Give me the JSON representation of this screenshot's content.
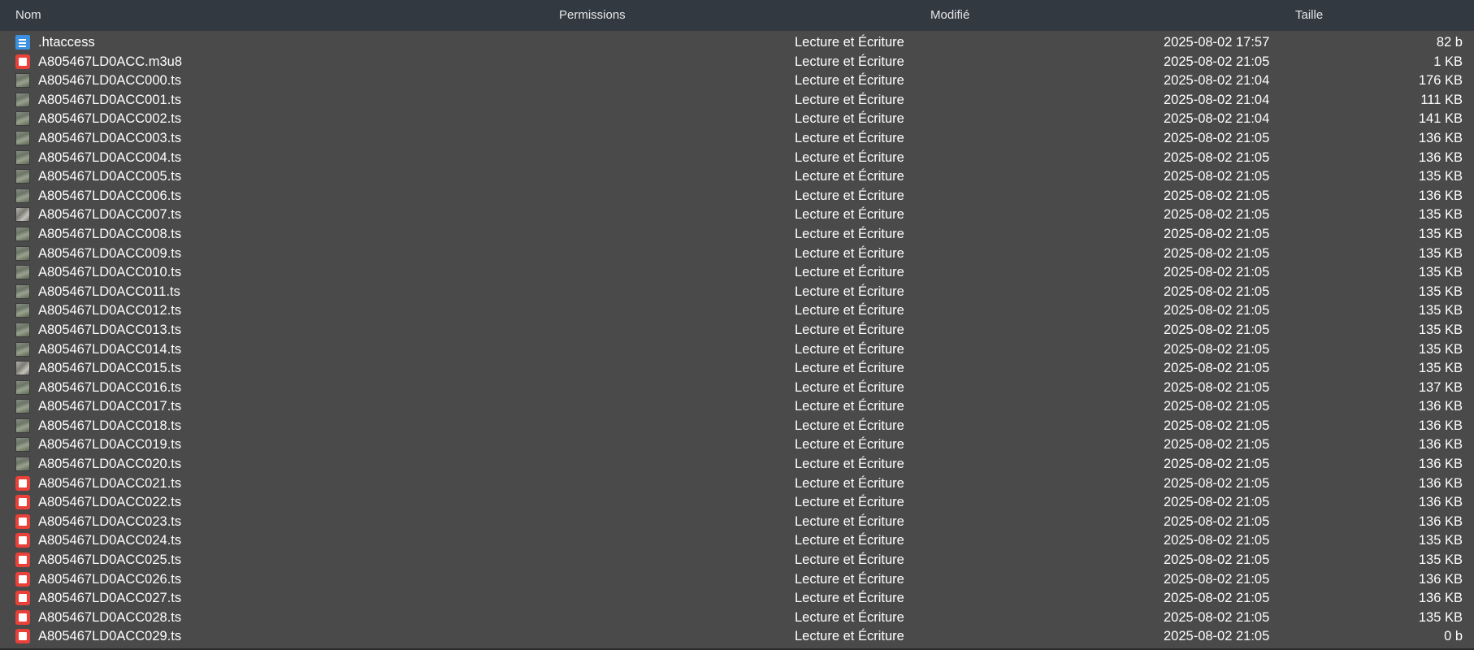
{
  "columns": {
    "name": "Nom",
    "permissions": "Permissions",
    "modified": "Modifié",
    "size": "Taille"
  },
  "icons": {
    "text": "text-file-icon",
    "playlist": "media-file-icon",
    "thumbnail": "video-thumbnail-icon"
  },
  "colors": {
    "header_bg": "#333940",
    "panel_bg": "#4a4a4a",
    "doc_icon": "#3d8fe0",
    "media_icon": "#e8413a"
  },
  "files": [
    {
      "name": ".htaccess",
      "permissions": "Lecture et Écriture",
      "modified": "2025-08-02 17:57",
      "size": "82 b",
      "icon": "text-file-icon"
    },
    {
      "name": "A805467LD0ACC.m3u8",
      "permissions": "Lecture et Écriture",
      "modified": "2025-08-02 21:05",
      "size": "1 KB",
      "icon": "media-file-icon"
    },
    {
      "name": "A805467LD0ACC000.ts",
      "permissions": "Lecture et Écriture",
      "modified": "2025-08-02 21:04",
      "size": "176 KB",
      "icon": "video-thumbnail-icon"
    },
    {
      "name": "A805467LD0ACC001.ts",
      "permissions": "Lecture et Écriture",
      "modified": "2025-08-02 21:04",
      "size": "111 KB",
      "icon": "video-thumbnail-icon"
    },
    {
      "name": "A805467LD0ACC002.ts",
      "permissions": "Lecture et Écriture",
      "modified": "2025-08-02 21:04",
      "size": "141 KB",
      "icon": "video-thumbnail-icon"
    },
    {
      "name": "A805467LD0ACC003.ts",
      "permissions": "Lecture et Écriture",
      "modified": "2025-08-02 21:05",
      "size": "136 KB",
      "icon": "video-thumbnail-icon"
    },
    {
      "name": "A805467LD0ACC004.ts",
      "permissions": "Lecture et Écriture",
      "modified": "2025-08-02 21:05",
      "size": "136 KB",
      "icon": "video-thumbnail-icon"
    },
    {
      "name": "A805467LD0ACC005.ts",
      "permissions": "Lecture et Écriture",
      "modified": "2025-08-02 21:05",
      "size": "135 KB",
      "icon": "video-thumbnail-icon"
    },
    {
      "name": "A805467LD0ACC006.ts",
      "permissions": "Lecture et Écriture",
      "modified": "2025-08-02 21:05",
      "size": "136 KB",
      "icon": "video-thumbnail-icon"
    },
    {
      "name": "A805467LD0ACC007.ts",
      "permissions": "Lecture et Écriture",
      "modified": "2025-08-02 21:05",
      "size": "135 KB",
      "icon": "video-thumbnail-icon"
    },
    {
      "name": "A805467LD0ACC008.ts",
      "permissions": "Lecture et Écriture",
      "modified": "2025-08-02 21:05",
      "size": "135 KB",
      "icon": "video-thumbnail-icon"
    },
    {
      "name": "A805467LD0ACC009.ts",
      "permissions": "Lecture et Écriture",
      "modified": "2025-08-02 21:05",
      "size": "135 KB",
      "icon": "video-thumbnail-icon"
    },
    {
      "name": "A805467LD0ACC010.ts",
      "permissions": "Lecture et Écriture",
      "modified": "2025-08-02 21:05",
      "size": "135 KB",
      "icon": "video-thumbnail-icon"
    },
    {
      "name": "A805467LD0ACC011.ts",
      "permissions": "Lecture et Écriture",
      "modified": "2025-08-02 21:05",
      "size": "135 KB",
      "icon": "video-thumbnail-icon"
    },
    {
      "name": "A805467LD0ACC012.ts",
      "permissions": "Lecture et Écriture",
      "modified": "2025-08-02 21:05",
      "size": "135 KB",
      "icon": "video-thumbnail-icon"
    },
    {
      "name": "A805467LD0ACC013.ts",
      "permissions": "Lecture et Écriture",
      "modified": "2025-08-02 21:05",
      "size": "135 KB",
      "icon": "video-thumbnail-icon"
    },
    {
      "name": "A805467LD0ACC014.ts",
      "permissions": "Lecture et Écriture",
      "modified": "2025-08-02 21:05",
      "size": "135 KB",
      "icon": "video-thumbnail-icon"
    },
    {
      "name": "A805467LD0ACC015.ts",
      "permissions": "Lecture et Écriture",
      "modified": "2025-08-02 21:05",
      "size": "135 KB",
      "icon": "video-thumbnail-icon"
    },
    {
      "name": "A805467LD0ACC016.ts",
      "permissions": "Lecture et Écriture",
      "modified": "2025-08-02 21:05",
      "size": "137 KB",
      "icon": "video-thumbnail-icon"
    },
    {
      "name": "A805467LD0ACC017.ts",
      "permissions": "Lecture et Écriture",
      "modified": "2025-08-02 21:05",
      "size": "136 KB",
      "icon": "video-thumbnail-icon"
    },
    {
      "name": "A805467LD0ACC018.ts",
      "permissions": "Lecture et Écriture",
      "modified": "2025-08-02 21:05",
      "size": "136 KB",
      "icon": "video-thumbnail-icon"
    },
    {
      "name": "A805467LD0ACC019.ts",
      "permissions": "Lecture et Écriture",
      "modified": "2025-08-02 21:05",
      "size": "136 KB",
      "icon": "video-thumbnail-icon"
    },
    {
      "name": "A805467LD0ACC020.ts",
      "permissions": "Lecture et Écriture",
      "modified": "2025-08-02 21:05",
      "size": "136 KB",
      "icon": "video-thumbnail-icon"
    },
    {
      "name": "A805467LD0ACC021.ts",
      "permissions": "Lecture et Écriture",
      "modified": "2025-08-02 21:05",
      "size": "136 KB",
      "icon": "media-file-icon"
    },
    {
      "name": "A805467LD0ACC022.ts",
      "permissions": "Lecture et Écriture",
      "modified": "2025-08-02 21:05",
      "size": "136 KB",
      "icon": "media-file-icon"
    },
    {
      "name": "A805467LD0ACC023.ts",
      "permissions": "Lecture et Écriture",
      "modified": "2025-08-02 21:05",
      "size": "136 KB",
      "icon": "media-file-icon"
    },
    {
      "name": "A805467LD0ACC024.ts",
      "permissions": "Lecture et Écriture",
      "modified": "2025-08-02 21:05",
      "size": "135 KB",
      "icon": "media-file-icon"
    },
    {
      "name": "A805467LD0ACC025.ts",
      "permissions": "Lecture et Écriture",
      "modified": "2025-08-02 21:05",
      "size": "135 KB",
      "icon": "media-file-icon"
    },
    {
      "name": "A805467LD0ACC026.ts",
      "permissions": "Lecture et Écriture",
      "modified": "2025-08-02 21:05",
      "size": "136 KB",
      "icon": "media-file-icon"
    },
    {
      "name": "A805467LD0ACC027.ts",
      "permissions": "Lecture et Écriture",
      "modified": "2025-08-02 21:05",
      "size": "136 KB",
      "icon": "media-file-icon"
    },
    {
      "name": "A805467LD0ACC028.ts",
      "permissions": "Lecture et Écriture",
      "modified": "2025-08-02 21:05",
      "size": "135 KB",
      "icon": "media-file-icon"
    },
    {
      "name": "A805467LD0ACC029.ts",
      "permissions": "Lecture et Écriture",
      "modified": "2025-08-02 21:05",
      "size": "0 b",
      "icon": "media-file-icon"
    }
  ]
}
